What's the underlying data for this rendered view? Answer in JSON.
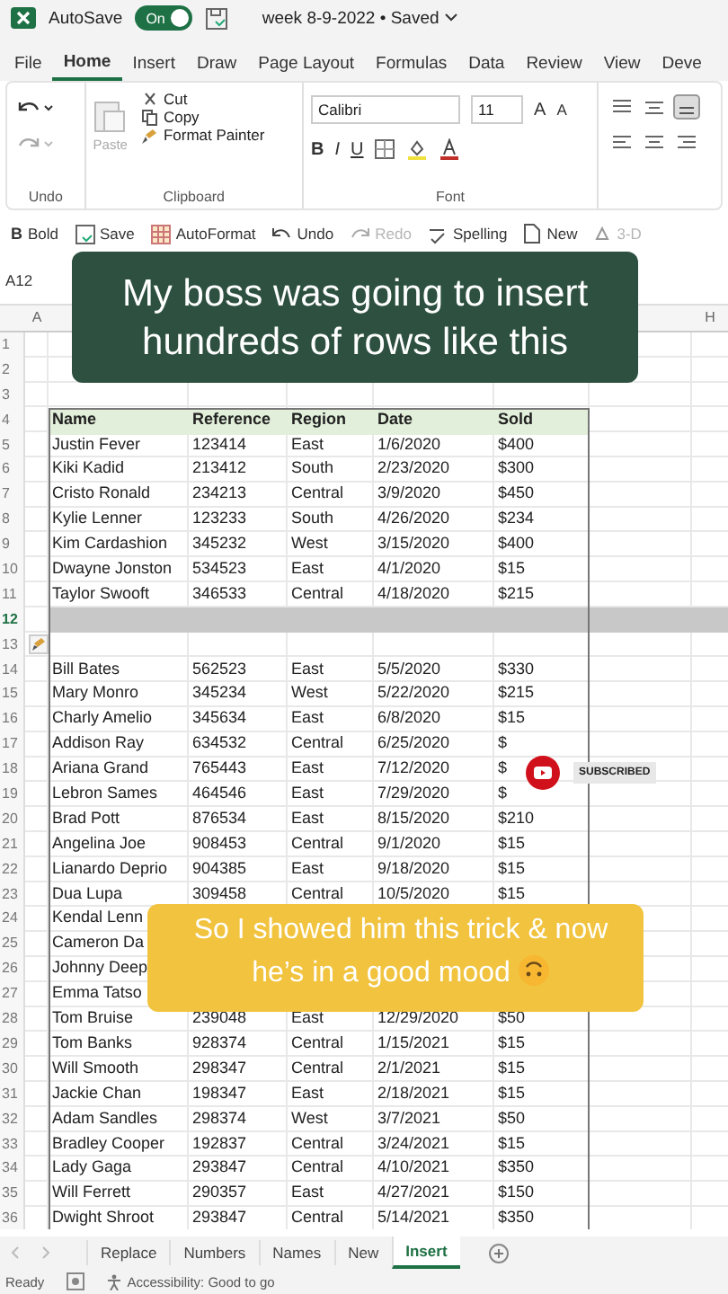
{
  "title_bar": {
    "autosave_label": "AutoSave",
    "autosave": {
      "label": "On",
      "on": true
    },
    "document_title": "week 8-9-2022 • Saved"
  },
  "menu_tabs": [
    {
      "label": "File",
      "selected": false
    },
    {
      "label": "Home",
      "selected": true
    },
    {
      "label": "Insert",
      "selected": false
    },
    {
      "label": "Draw",
      "selected": false
    },
    {
      "label": "Page Layout",
      "selected": false
    },
    {
      "label": "Formulas",
      "selected": false
    },
    {
      "label": "Data",
      "selected": false
    },
    {
      "label": "Review",
      "selected": false
    },
    {
      "label": "View",
      "selected": false
    },
    {
      "label": "Deve",
      "selected": false
    }
  ],
  "ribbon": {
    "undo_group": "Undo",
    "clipboard": {
      "paste": "Paste",
      "cut": "Cut",
      "copy": "Copy",
      "format_painter": "Format Painter",
      "label": "Clipboard"
    },
    "font": {
      "font_name": "Calibri",
      "font_size": "11",
      "grow": "A",
      "shrink": "A",
      "bold": "B",
      "italic": "I",
      "underline": "U",
      "label": "Font"
    }
  },
  "quick_access": [
    {
      "kind": "bold",
      "glyph": "B",
      "label": "Bold",
      "disabled": false
    },
    {
      "kind": "save",
      "label": "Save",
      "disabled": false
    },
    {
      "kind": "table",
      "label": "AutoFormat",
      "disabled": false
    },
    {
      "kind": "undo",
      "label": "Undo",
      "disabled": false
    },
    {
      "kind": "redo",
      "label": "Redo",
      "disabled": true
    },
    {
      "kind": "spelling",
      "label": "Spelling",
      "disabled": false
    },
    {
      "kind": "new",
      "label": "New",
      "disabled": false
    },
    {
      "kind": "shape",
      "label": "3-D",
      "disabled": true
    }
  ],
  "name_box": "A12",
  "column_headers": [
    "A",
    "H"
  ],
  "rows": [
    {
      "number": "1",
      "kind": "empty"
    },
    {
      "number": "2",
      "kind": "empty"
    },
    {
      "number": "3",
      "kind": "empty"
    },
    {
      "number": "4",
      "kind": "header",
      "cells": [
        "Name",
        "Reference",
        "Region",
        "Date",
        "Sold"
      ]
    },
    {
      "number": "5",
      "kind": "data",
      "cells": [
        "Justin Fever",
        "123414",
        "East",
        "1/6/2020",
        "$400"
      ]
    },
    {
      "number": "6",
      "kind": "data",
      "cells": [
        "Kiki Kadid",
        "213412",
        "South",
        "2/23/2020",
        "$300"
      ]
    },
    {
      "number": "7",
      "kind": "data",
      "cells": [
        "Cristo Ronald",
        "234213",
        "Central",
        "3/9/2020",
        "$450"
      ]
    },
    {
      "number": "8",
      "kind": "data",
      "cells": [
        "Kylie Lenner",
        "123233",
        "South",
        "4/26/2020",
        "$234"
      ]
    },
    {
      "number": "9",
      "kind": "data",
      "cells": [
        "Kim Cardashion",
        "345232",
        "West",
        "3/15/2020",
        "$400"
      ]
    },
    {
      "number": "10",
      "kind": "data",
      "cells": [
        "Dwayne Jonston",
        "534523",
        "East",
        "4/1/2020",
        "$15"
      ]
    },
    {
      "number": "11",
      "kind": "data",
      "cells": [
        "Taylor Swooft",
        "346533",
        "Central",
        "4/18/2020",
        "$215"
      ]
    },
    {
      "number": "12",
      "kind": "selected"
    },
    {
      "number": "13",
      "kind": "insert_options"
    },
    {
      "number": "14",
      "kind": "data",
      "cells": [
        "Bill Bates",
        "562523",
        "East",
        "5/5/2020",
        "$330"
      ]
    },
    {
      "number": "15",
      "kind": "data",
      "cells": [
        "Mary Monro",
        "345234",
        "West",
        "5/22/2020",
        "$215"
      ]
    },
    {
      "number": "16",
      "kind": "data",
      "cells": [
        "Charly Amelio",
        "345634",
        "East",
        "6/8/2020",
        "$15"
      ]
    },
    {
      "number": "17",
      "kind": "data",
      "cells": [
        "Addison Ray",
        "634532",
        "Central",
        "6/25/2020",
        "$"
      ]
    },
    {
      "number": "18",
      "kind": "data",
      "cells": [
        "Ariana Grand",
        "765443",
        "East",
        "7/12/2020",
        "$"
      ]
    },
    {
      "number": "19",
      "kind": "data",
      "cells": [
        "Lebron Sames",
        "464546",
        "East",
        "7/29/2020",
        "$"
      ]
    },
    {
      "number": "20",
      "kind": "data",
      "cells": [
        "Brad Pott",
        "876534",
        "East",
        "8/15/2020",
        "$210"
      ]
    },
    {
      "number": "21",
      "kind": "data",
      "cells": [
        "Angelina Joe",
        "908453",
        "Central",
        "9/1/2020",
        "$15"
      ]
    },
    {
      "number": "22",
      "kind": "data",
      "cells": [
        "Lianardo Deprio",
        "904385",
        "East",
        "9/18/2020",
        "$15"
      ]
    },
    {
      "number": "23",
      "kind": "data",
      "cells": [
        "Dua Lupa",
        "309458",
        "Central",
        "10/5/2020",
        "$15"
      ]
    },
    {
      "number": "24",
      "kind": "data",
      "cells": [
        "Kendal Lenn"
      ]
    },
    {
      "number": "25",
      "kind": "data",
      "cells": [
        "Cameron Da"
      ]
    },
    {
      "number": "26",
      "kind": "data",
      "cells": [
        "Johnny Deep"
      ]
    },
    {
      "number": "27",
      "kind": "data",
      "cells": [
        "Emma Tatso"
      ]
    },
    {
      "number": "28",
      "kind": "data",
      "cells": [
        "Tom Bruise",
        "239048",
        "East",
        "12/29/2020",
        "$50"
      ]
    },
    {
      "number": "29",
      "kind": "data",
      "cells": [
        "Tom Banks",
        "928374",
        "Central",
        "1/15/2021",
        "$15"
      ]
    },
    {
      "number": "30",
      "kind": "data",
      "cells": [
        "Will Smooth",
        "298347",
        "Central",
        "2/1/2021",
        "$15"
      ]
    },
    {
      "number": "31",
      "kind": "data",
      "cells": [
        "Jackie Chan",
        "198347",
        "East",
        "2/18/2021",
        "$15"
      ]
    },
    {
      "number": "32",
      "kind": "data",
      "cells": [
        "Adam Sandles",
        "298374",
        "West",
        "3/7/2021",
        "$50"
      ]
    },
    {
      "number": "33",
      "kind": "data",
      "cells": [
        "Bradley Cooper",
        "192837",
        "Central",
        "3/24/2021",
        "$15"
      ]
    },
    {
      "number": "34",
      "kind": "data",
      "cells": [
        "Lady Gaga",
        "293847",
        "Central",
        "4/10/2021",
        "$350"
      ]
    },
    {
      "number": "35",
      "kind": "data",
      "cells": [
        "Will Ferrett",
        "290357",
        "East",
        "4/27/2021",
        "$150"
      ]
    },
    {
      "number": "36",
      "kind": "data",
      "cells": [
        "Dwight Shroot",
        "293847",
        "Central",
        "5/14/2021",
        "$350"
      ]
    }
  ],
  "captions": [
    {
      "kind": "dark",
      "text": "My boss was going to insert hundreds of rows like this"
    },
    {
      "kind": "yellow",
      "text": "So I showed him this trick & now he’s in a good mood",
      "emoji": true
    }
  ],
  "subscribe_badge": {
    "label": "SUBSCRIBED"
  },
  "sheet_tabs": [
    {
      "label": "Replace",
      "selected": false
    },
    {
      "label": "Numbers",
      "selected": false
    },
    {
      "label": "Names",
      "selected": false
    },
    {
      "label": "New",
      "selected": false
    },
    {
      "label": "Insert",
      "selected": true
    }
  ],
  "status_bar": {
    "ready": "Ready",
    "accessibility": "Accessibility: Good to go"
  }
}
